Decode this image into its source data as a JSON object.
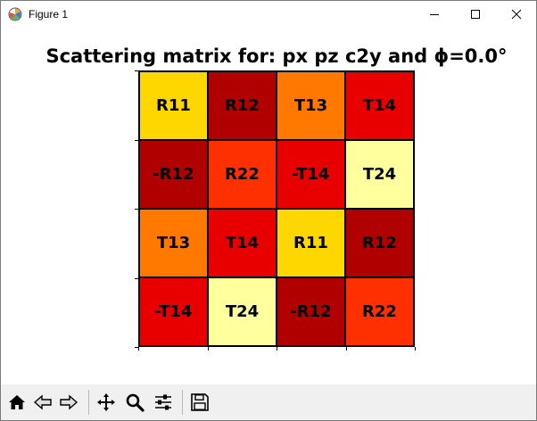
{
  "window": {
    "title": "Figure 1"
  },
  "figure": {
    "title": "Scattering matrix for: px pz c2y and ϕ=0.0°"
  },
  "matrix": {
    "rows": [
      [
        {
          "label": "R11",
          "color": "#ffd700"
        },
        {
          "label": "R12",
          "color": "#b00000"
        },
        {
          "label": "T13",
          "color": "#ff7800"
        },
        {
          "label": "T14",
          "color": "#e80000"
        }
      ],
      [
        {
          "label": "-R12",
          "color": "#b00000"
        },
        {
          "label": "R22",
          "color": "#ff3000"
        },
        {
          "label": "-T14",
          "color": "#e80000"
        },
        {
          "label": "T24",
          "color": "#ffff9e"
        }
      ],
      [
        {
          "label": "T13",
          "color": "#ff7800"
        },
        {
          "label": "T14",
          "color": "#e80000"
        },
        {
          "label": "R11",
          "color": "#ffd700"
        },
        {
          "label": "R12",
          "color": "#b00000"
        }
      ],
      [
        {
          "label": "-T14",
          "color": "#e80000"
        },
        {
          "label": "T24",
          "color": "#ffff9e"
        },
        {
          "label": "-R12",
          "color": "#b00000"
        },
        {
          "label": "R22",
          "color": "#ff3000"
        }
      ]
    ]
  },
  "toolbar": {
    "buttons": [
      "home-icon",
      "back-icon",
      "forward-icon",
      "pan-icon",
      "zoom-icon",
      "configure-subplots-icon",
      "save-icon"
    ]
  }
}
